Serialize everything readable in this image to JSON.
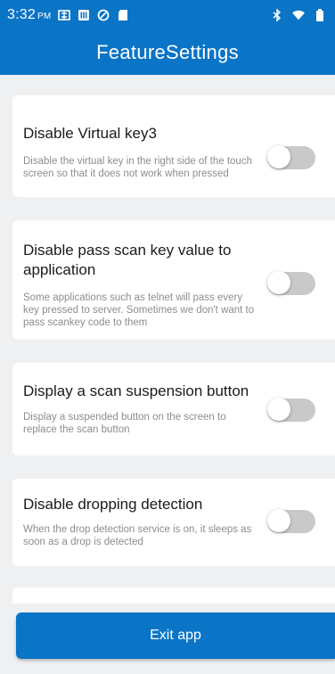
{
  "status_bar": {
    "time": "3:32",
    "ampm": "PM",
    "icons_left": [
      "sim-icon",
      "storage-icon",
      "sync-icon",
      "sd-card-icon"
    ],
    "icons_right": [
      "bluetooth-icon",
      "wifi-icon",
      "battery-icon"
    ]
  },
  "app_bar": {
    "title": "FeatureSettings"
  },
  "settings": [
    {
      "title": "Disable Virtual key3",
      "description": "Disable the virtual key in the right side of the touch screen so that it does not work when pressed",
      "enabled": false
    },
    {
      "title": "Disable pass scan key value to application",
      "description": "Some applications such as telnet will pass every key pressed to server. Sometimes we don't want to pass scankey code to them",
      "enabled": false
    },
    {
      "title": "Display a scan suspension button",
      "description": "Display a suspended button on the screen to replace the scan button",
      "enabled": false
    },
    {
      "title": "Disable dropping detection",
      "description": "When the drop detection service is on, it sleeps as soon as a drop is detected",
      "enabled": false
    }
  ],
  "exit_button": {
    "label": "Exit app"
  },
  "colors": {
    "primary": "#0a74c7",
    "background": "#eef0f2",
    "toggle_off_track": "#c9c9c9",
    "description_text": "#8a8d90"
  }
}
